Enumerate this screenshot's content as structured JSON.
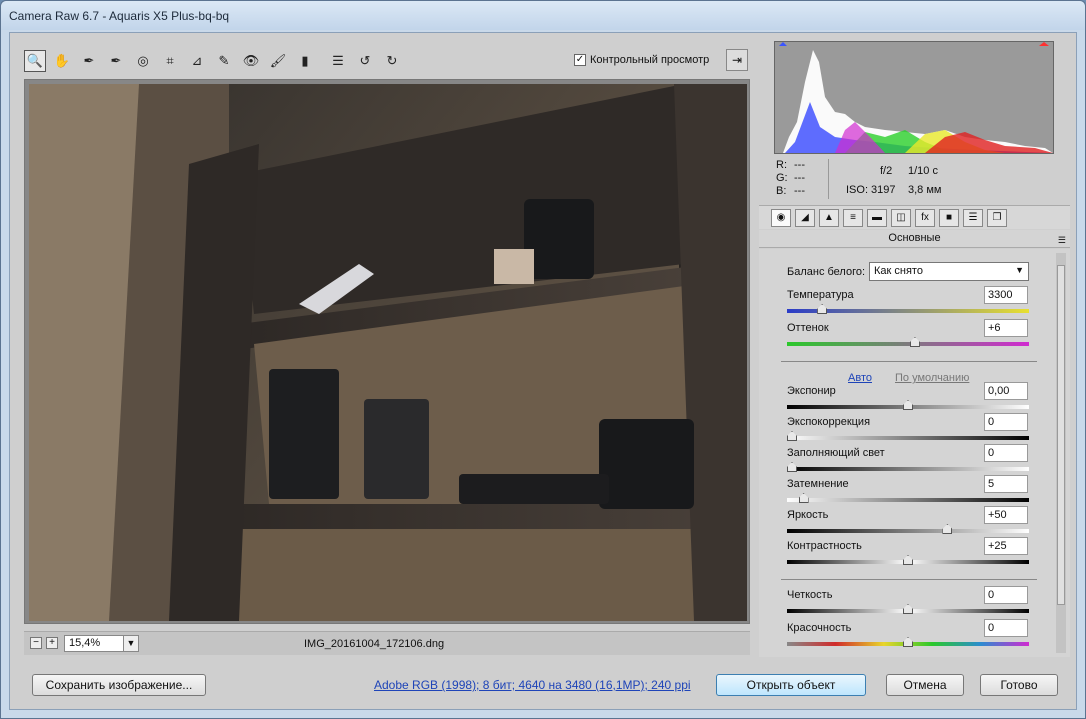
{
  "window": {
    "title": "Camera Raw 6.7  -  Aquaris X5 Plus-bq-bq"
  },
  "toolbar": {
    "tools": [
      {
        "name": "zoom-tool-icon",
        "glyph": "🔍"
      },
      {
        "name": "hand-tool-icon",
        "glyph": "✋"
      },
      {
        "name": "white-balance-tool-icon",
        "glyph": "✒"
      },
      {
        "name": "color-sampler-tool-icon",
        "glyph": "✒"
      },
      {
        "name": "targeted-adjustment-tool-icon",
        "glyph": "◎"
      },
      {
        "name": "crop-tool-icon",
        "glyph": "⌗"
      },
      {
        "name": "straighten-tool-icon",
        "glyph": "⊿"
      },
      {
        "name": "spot-removal-tool-icon",
        "glyph": "✎"
      },
      {
        "name": "red-eye-tool-icon",
        "glyph": "👁"
      },
      {
        "name": "adjustment-brush-icon",
        "glyph": "🖌"
      },
      {
        "name": "graduated-filter-icon",
        "glyph": "▮"
      },
      {
        "name": "preferences-icon",
        "glyph": "☰"
      },
      {
        "name": "rotate-ccw-icon",
        "glyph": "↺"
      },
      {
        "name": "rotate-cw-icon",
        "glyph": "↻"
      }
    ],
    "preview_label": "Контрольный просмотр",
    "preview_checked": "✓"
  },
  "bottom": {
    "zoom": "15,4%",
    "minus": "−",
    "plus": "+",
    "filename": "IMG_20161004_172106.dng"
  },
  "readout": {
    "r": "R:",
    "g": "G:",
    "b": "B:",
    "dash": "---",
    "aperture": "f/2",
    "shutter": "1/10 с",
    "iso": "ISO: 3197",
    "focal": "3,8 мм"
  },
  "panel": {
    "title": "Основные",
    "wb_label": "Баланс белого:",
    "wb_value": "Как снято",
    "auto": "Авто",
    "default": "По умолчанию",
    "sliders": [
      {
        "label": "Температура",
        "value": "3300",
        "pos": 0.13,
        "grad": "linear-gradient(90deg,#2a3cc8,#e8e030)"
      },
      {
        "label": "Оттенок",
        "value": "+6",
        "pos": 0.53,
        "grad": "linear-gradient(90deg,#2bc82b,#d02bd0)"
      },
      {
        "label": "Экспонир",
        "value": "0,00",
        "pos": 0.5,
        "grad": "linear-gradient(90deg,#000,#fff)"
      },
      {
        "label": "Экспокоррекция",
        "value": "0",
        "pos": 0.0,
        "grad": "linear-gradient(90deg,#fff,#000)"
      },
      {
        "label": "Заполняющий свет",
        "value": "0",
        "pos": 0.0,
        "grad": "linear-gradient(90deg,#000,#fff)"
      },
      {
        "label": "Затемнение",
        "value": "5",
        "pos": 0.05,
        "grad": "linear-gradient(90deg,#fff,#000)"
      },
      {
        "label": "Яркость",
        "value": "+50",
        "pos": 0.67,
        "grad": "linear-gradient(90deg,#000,#fff)"
      },
      {
        "label": "Контрастность",
        "value": "+25",
        "pos": 0.5,
        "grad": "linear-gradient(90deg,#000,#fff,#000)"
      },
      {
        "label": "Четкость",
        "value": "0",
        "pos": 0.5,
        "grad": "linear-gradient(90deg,#000,#fff,#000)"
      },
      {
        "label": "Красочность",
        "value": "0",
        "pos": 0.5,
        "grad": "linear-gradient(90deg,#888,#d02b2b,#e8d52b,#2bc82b,#2b8cd0,#d02bd0)"
      }
    ]
  },
  "footer": {
    "save": "Сохранить изображение...",
    "workflow": "Adobe RGB (1998); 8 бит; 4640 на 3480 (16,1MP); 240 ppi",
    "open": "Открыть объект",
    "cancel": "Отмена",
    "done": "Готово"
  },
  "colors": {
    "link": "#1e44b8",
    "primary_button": "#bee6fd"
  }
}
